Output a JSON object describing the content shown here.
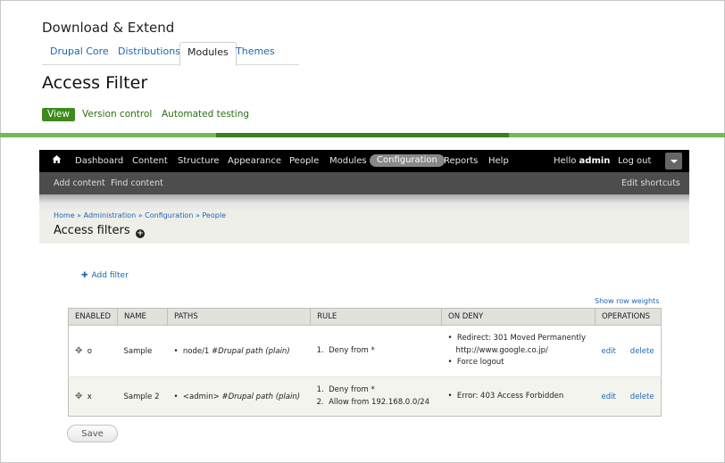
{
  "download": {
    "title": "Download & Extend",
    "tabs": [
      "Drupal Core",
      "Distributions",
      "Modules",
      "Themes"
    ]
  },
  "project": {
    "title": "Access Filter",
    "subnav": [
      "View",
      "Version control",
      "Automated testing"
    ]
  },
  "toolbar": {
    "menu": [
      "Dashboard",
      "Content",
      "Structure",
      "Appearance",
      "People",
      "Modules",
      "Configuration",
      "Reports",
      "Help"
    ],
    "hello": "Hello ",
    "user": "admin",
    "logout": "Log out"
  },
  "shortcuts": {
    "items": [
      "Add content",
      "Find content"
    ],
    "edit": "Edit shortcuts"
  },
  "page": {
    "breadcrumb": [
      "Home",
      "Administration",
      "Configuration",
      "People"
    ],
    "title": "Access filters"
  },
  "actions": {
    "add_filter": "Add filter",
    "row_weights": "Show row weights",
    "save": "Save"
  },
  "table": {
    "headers": [
      "ENABLED",
      "NAME",
      "PATHS",
      "RULE",
      "ON DENY",
      "OPERATIONS"
    ],
    "rows": [
      {
        "enabled": "o",
        "name": "Sample",
        "path": "node/1",
        "path_type": "#Drupal path (plain)",
        "rules": [
          "Deny from *"
        ],
        "on_deny": [
          "Redirect: 301 Moved Permanently",
          "http://www.google.co.jp/",
          "Force logout"
        ],
        "edit": "edit",
        "delete": "delete"
      },
      {
        "enabled": "x",
        "name": "Sample 2",
        "path": "<admin>",
        "path_type": "#Drupal path (plain)",
        "rules": [
          "Deny from *",
          "Allow from 192.168.0.0/24"
        ],
        "on_deny": [
          "Error: 403 Access Forbidden"
        ],
        "edit": "edit",
        "delete": "delete"
      }
    ]
  }
}
